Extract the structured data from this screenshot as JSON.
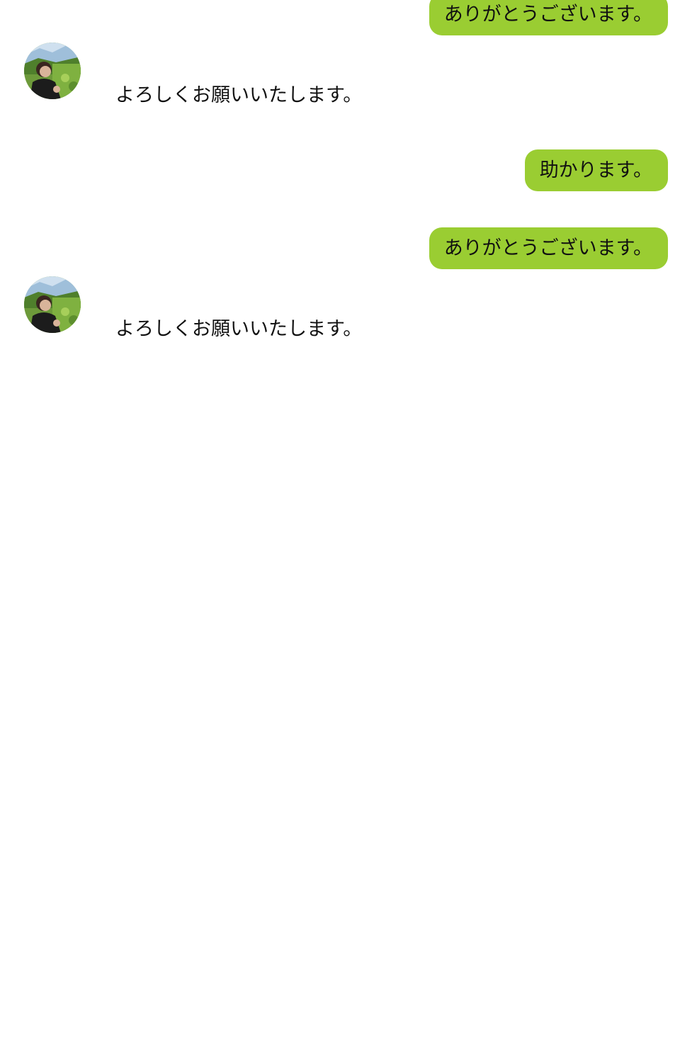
{
  "colors": {
    "accent": "#9acd32",
    "text": "#111111",
    "background": "#ffffff"
  },
  "messages": [
    {
      "type": "outgoing",
      "text": "ありがとうございます。"
    },
    {
      "type": "incoming",
      "sender": "",
      "avatar_icon": "user-photo-avatar",
      "text": "よろしくお願いいたします。"
    },
    {
      "type": "outgoing",
      "text": "助かります。"
    },
    {
      "type": "outgoing",
      "text": "ありがとうございます。"
    },
    {
      "type": "incoming",
      "sender": "",
      "avatar_icon": "user-photo-avatar",
      "text": "よろしくお願いいたします。"
    }
  ]
}
